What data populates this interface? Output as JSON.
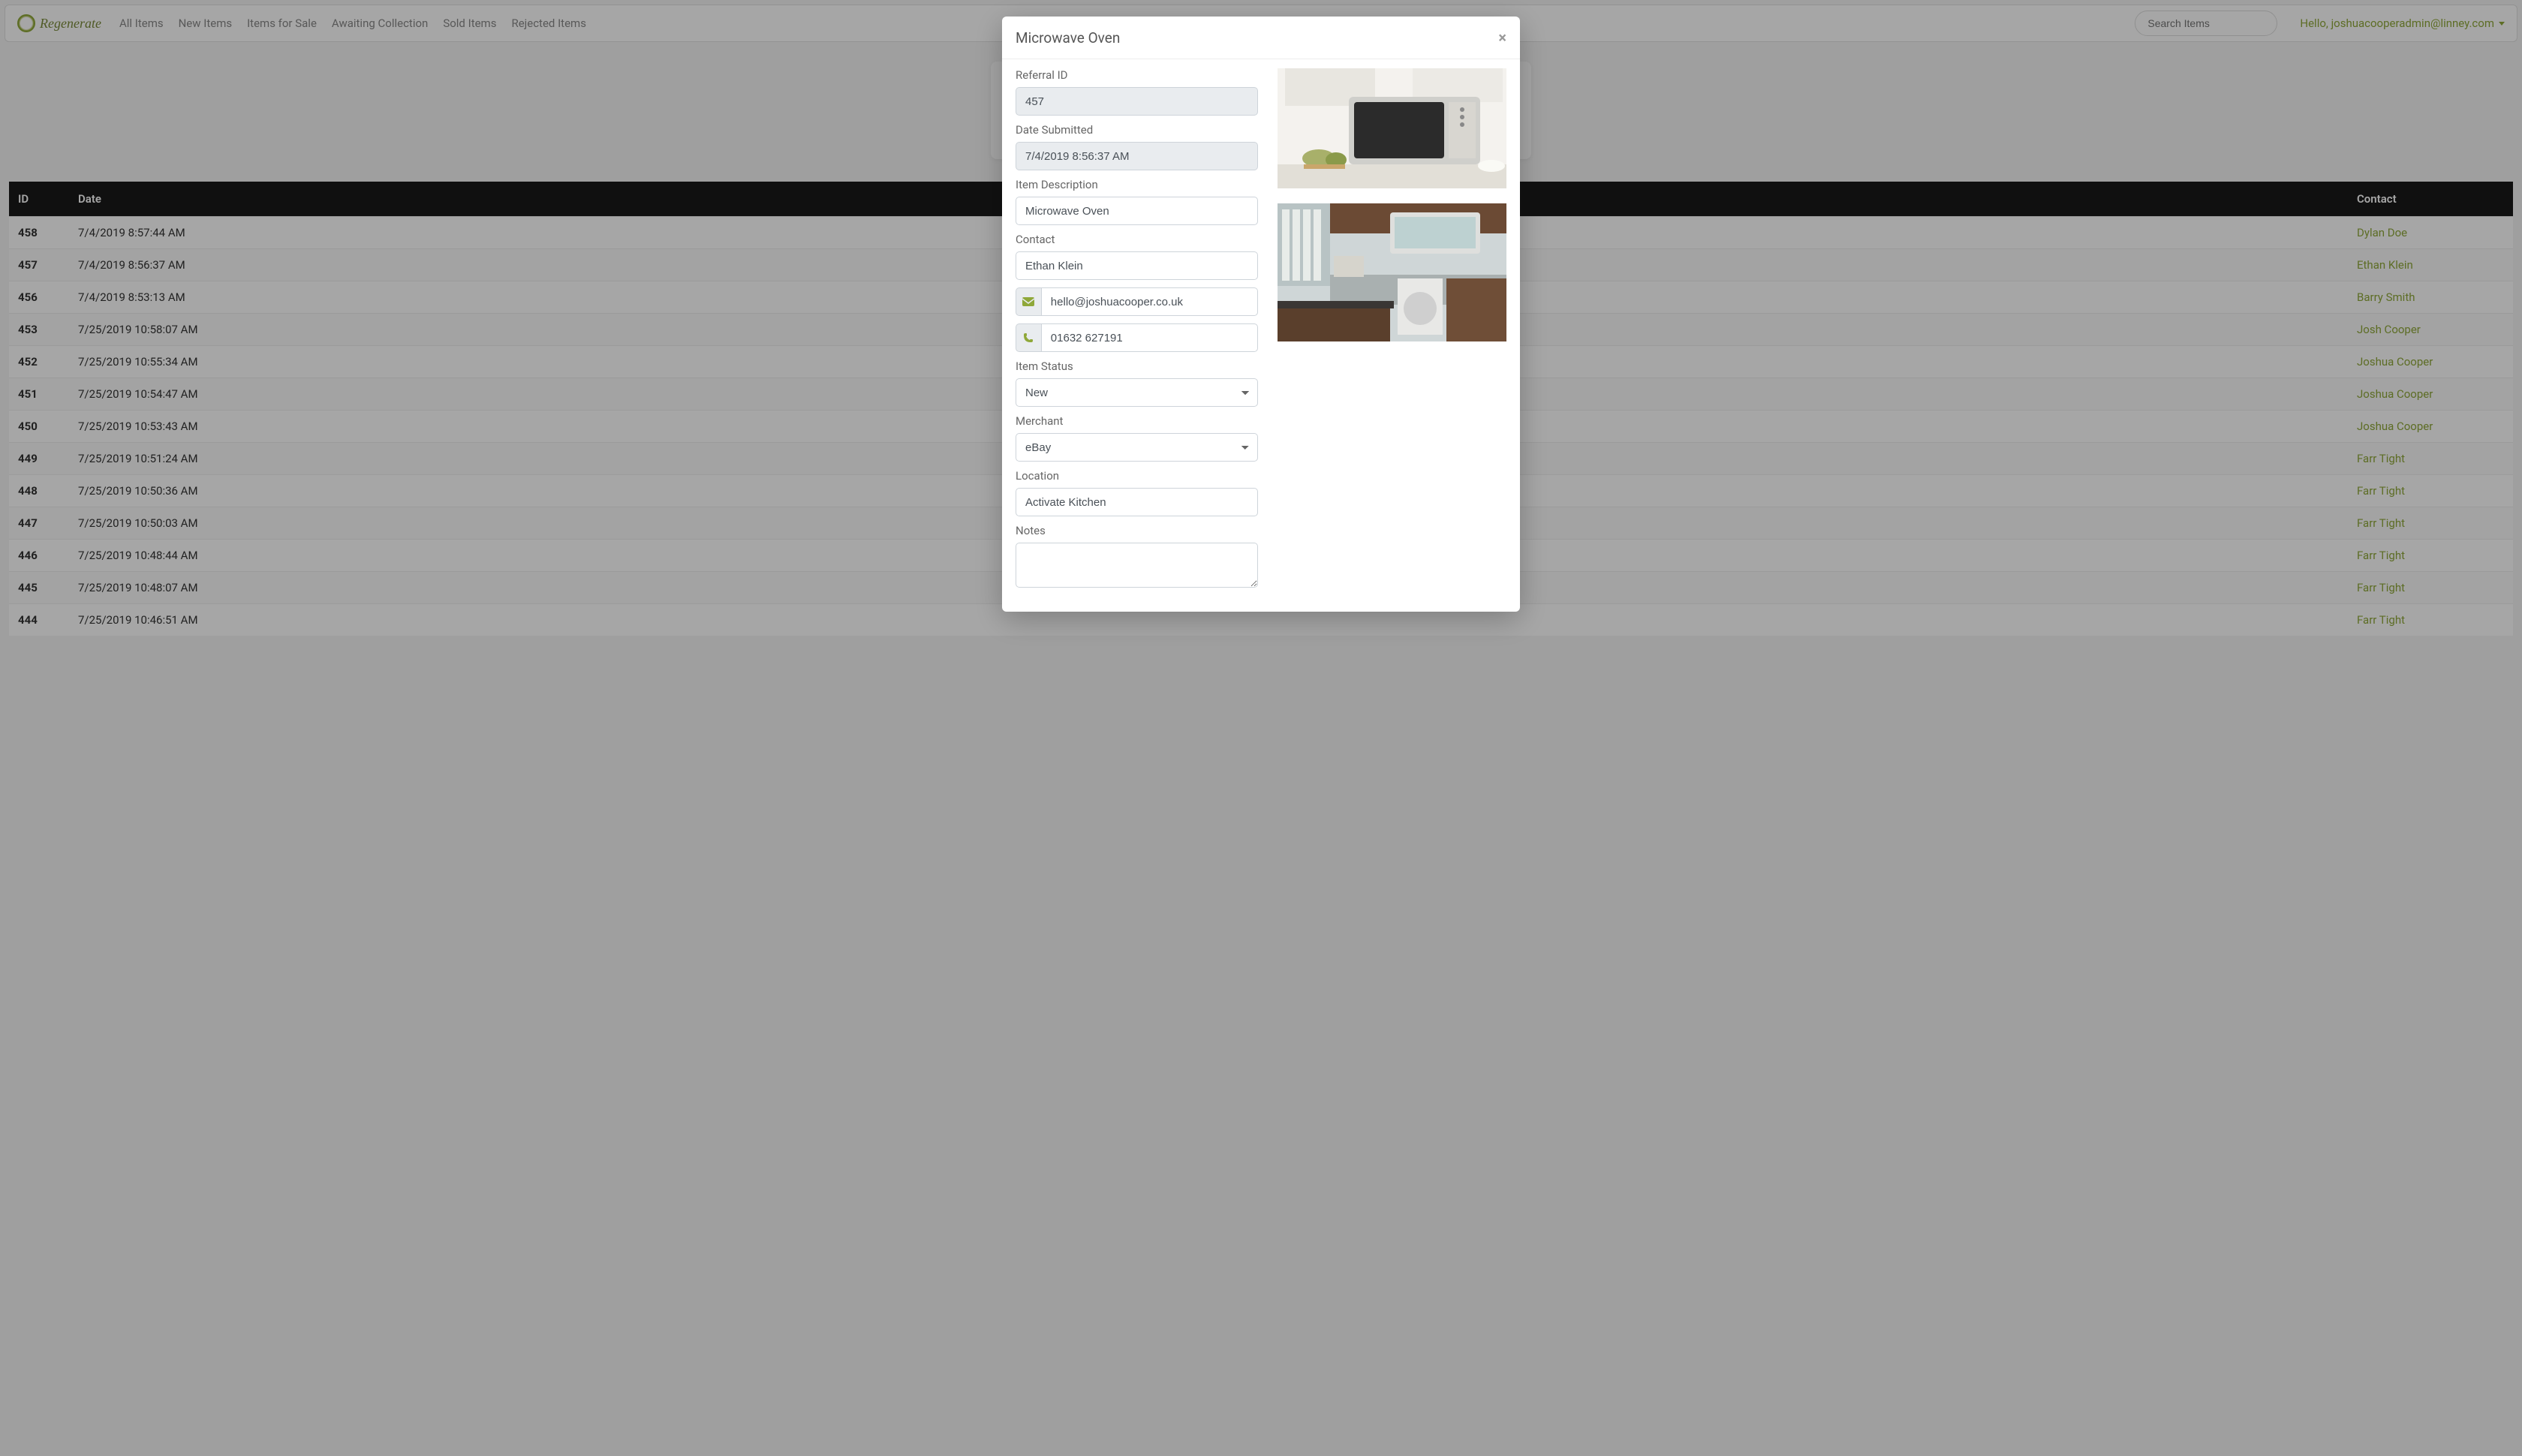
{
  "nav": {
    "logo_text": "Regenerate",
    "links": [
      "All Items",
      "New Items",
      "Items for Sale",
      "Awaiting Collection",
      "Sold Items",
      "Rejected Items"
    ],
    "search_placeholder": "Search Items",
    "greeting": "Hello, joshuacooperadmin@linney.com"
  },
  "table": {
    "headers": {
      "id": "ID",
      "date": "Date",
      "contact": "Contact"
    },
    "rows": [
      {
        "id": "458",
        "date": "7/4/2019 8:57:44 AM",
        "contact": "Dylan Doe"
      },
      {
        "id": "457",
        "date": "7/4/2019 8:56:37 AM",
        "contact": "Ethan Klein"
      },
      {
        "id": "456",
        "date": "7/4/2019 8:53:13 AM",
        "contact": "Barry Smith"
      },
      {
        "id": "453",
        "date": "7/25/2019 10:58:07 AM",
        "contact": "Josh Cooper"
      },
      {
        "id": "452",
        "date": "7/25/2019 10:55:34 AM",
        "contact": "Joshua Cooper"
      },
      {
        "id": "451",
        "date": "7/25/2019 10:54:47 AM",
        "contact": "Joshua Cooper"
      },
      {
        "id": "450",
        "date": "7/25/2019 10:53:43 AM",
        "contact": "Joshua Cooper"
      },
      {
        "id": "449",
        "date": "7/25/2019 10:51:24 AM",
        "contact": "Farr Tight"
      },
      {
        "id": "448",
        "date": "7/25/2019 10:50:36 AM",
        "contact": "Farr Tight"
      },
      {
        "id": "447",
        "date": "7/25/2019 10:50:03 AM",
        "contact": "Farr Tight"
      },
      {
        "id": "446",
        "date": "7/25/2019 10:48:44 AM",
        "contact": "Farr Tight"
      },
      {
        "id": "445",
        "date": "7/25/2019 10:48:07 AM",
        "contact": "Farr Tight"
      },
      {
        "id": "444",
        "date": "7/25/2019 10:46:51 AM",
        "contact": "Farr Tight"
      }
    ]
  },
  "modal": {
    "title": "Microwave Oven",
    "labels": {
      "referral_id": "Referral ID",
      "date_submitted": "Date Submitted",
      "item_description": "Item Description",
      "contact": "Contact",
      "item_status": "Item Status",
      "merchant": "Merchant",
      "location": "Location",
      "notes": "Notes"
    },
    "values": {
      "referral_id": "457",
      "date_submitted": "7/4/2019 8:56:37 AM",
      "item_description": "Microwave Oven",
      "contact": "Ethan Klein",
      "email": "hello@joshuacooper.co.uk",
      "phone": "01632 627191",
      "item_status": "New",
      "merchant": "eBay",
      "location": "Activate Kitchen",
      "notes": ""
    }
  }
}
